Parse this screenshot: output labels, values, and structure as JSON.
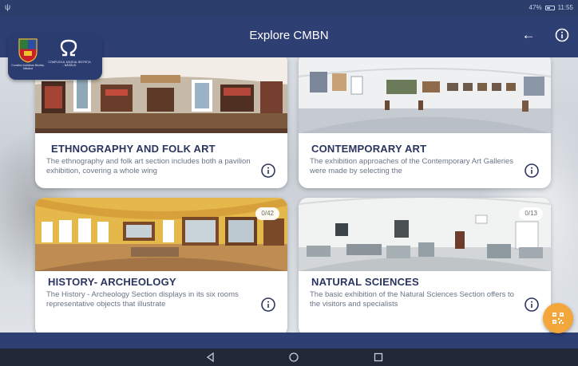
{
  "status_bar": {
    "left_icon": "usb-icon",
    "battery_text": "47%",
    "time": "11:55"
  },
  "app_bar": {
    "title": "Explore CMBN",
    "back_icon": "arrow-left-icon",
    "info_icon": "info-icon"
  },
  "logos": {
    "crest_caption": "Consiliul Județean Bistrița-Năsăud",
    "museum_caption": "COMPLEXUL MUZEAL BISTRIȚA - NĂSĂUD"
  },
  "cards": [
    {
      "title": "ETHNOGRAPHY AND FOLK ART",
      "description": "The ethnography and folk art section includes both a pavilion exhibition, covering a whole wing",
      "badge": ""
    },
    {
      "title": "CONTEMPORARY ART",
      "description": "The exhibition approaches of the Contemporary Art Galleries were made by selecting the",
      "badge": ""
    },
    {
      "title": "HISTORY- ARCHEOLOGY",
      "description": "The History - Archeology Section displays in its six rooms representative objects that illustrate",
      "badge": "0/42"
    },
    {
      "title": "NATURAL SCIENCES",
      "description": "The basic exhibition of the Natural Sciences Section offers to the visitors and specialists",
      "badge": "0/13"
    }
  ],
  "fab": {
    "icon": "qr-code-icon"
  },
  "nav_bar": {
    "back_icon": "nav-back-icon",
    "home_icon": "nav-home-icon",
    "recents_icon": "nav-recents-icon"
  },
  "colors": {
    "app_bar": "#2e3f74",
    "card_title": "#2a3560",
    "fab": "#f3a73b"
  }
}
